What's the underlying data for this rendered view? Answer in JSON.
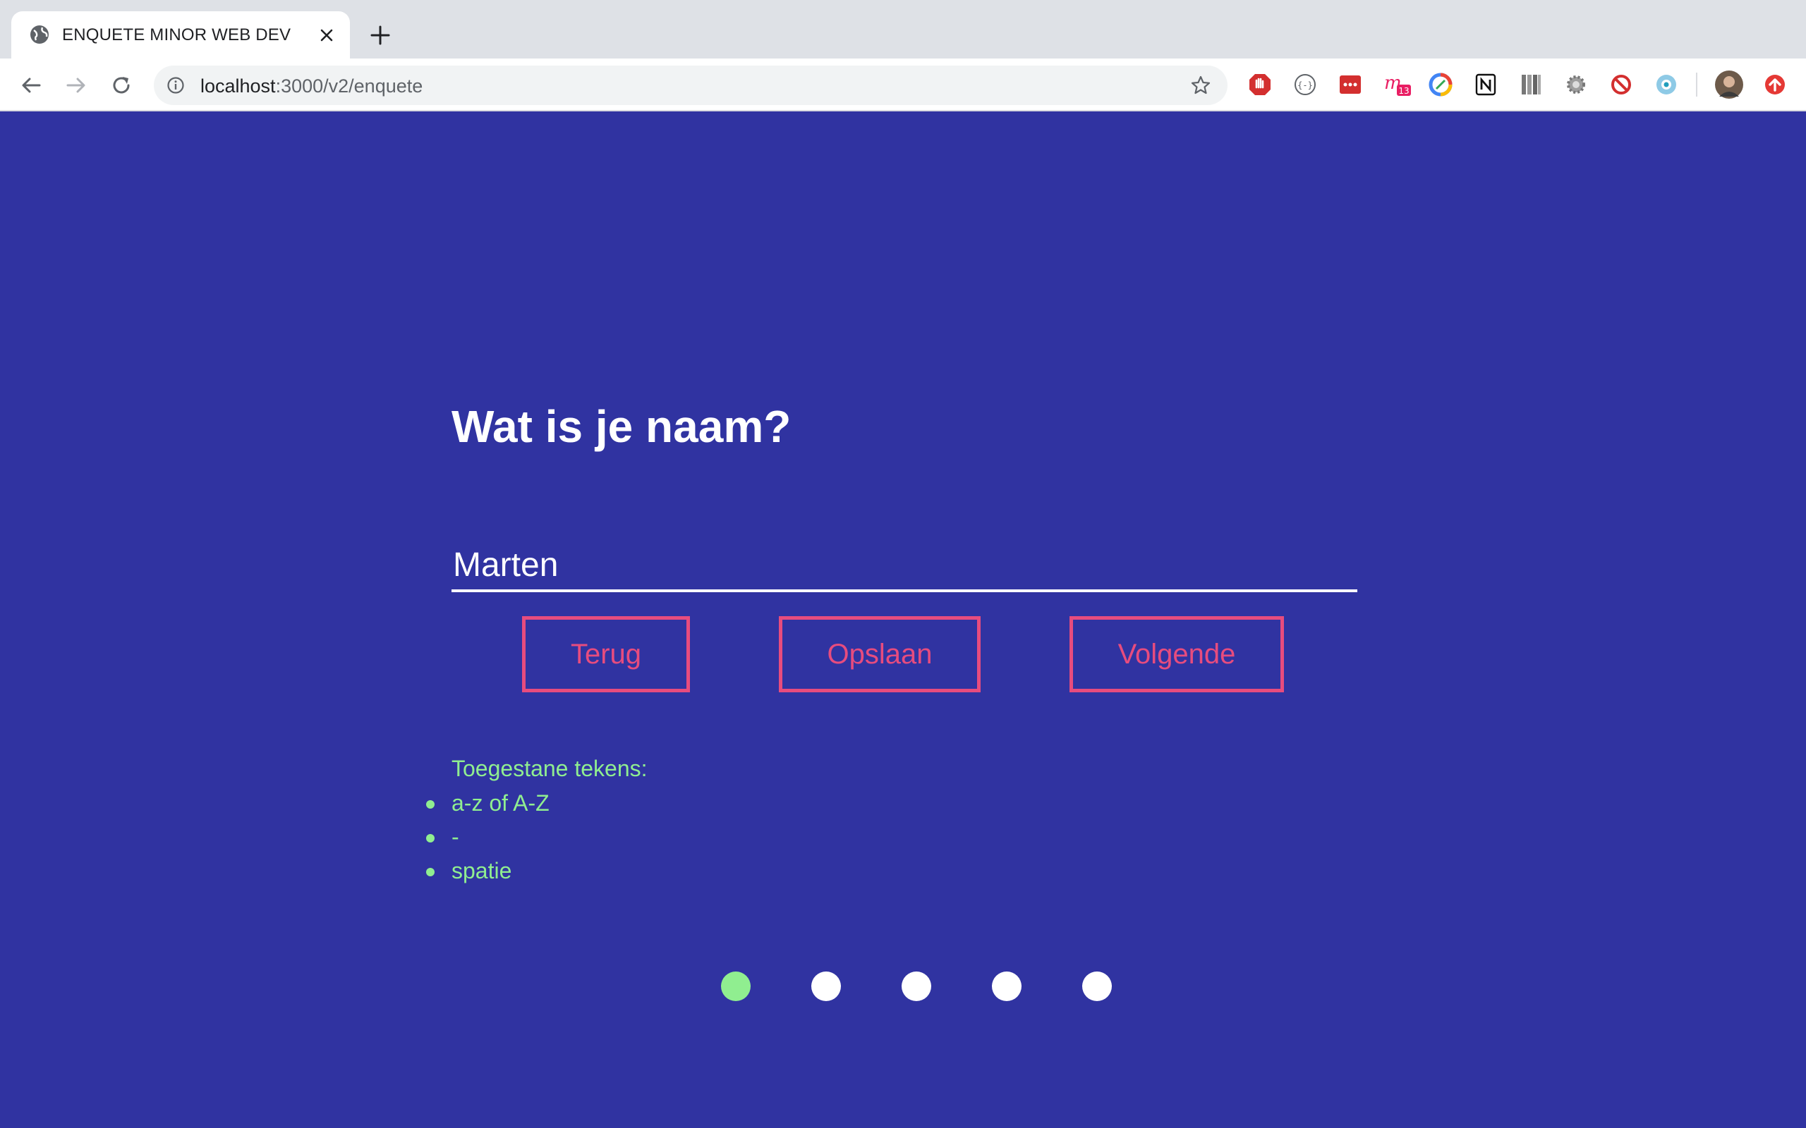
{
  "browser": {
    "tab": {
      "title": "ENQUETE MINOR WEB DEV"
    },
    "address": {
      "host": "localhost",
      "path": ":3000/v2/enquete"
    },
    "extensions": [
      "adblock-icon",
      "json-formatter-icon",
      "lastpass-icon",
      "mail-badge-icon",
      "color-picker-icon",
      "notion-icon",
      "archive-icon",
      "settings-gear-icon",
      "block-icon",
      "eye-icon",
      "profile-avatar",
      "update-icon"
    ],
    "badge_count": "13"
  },
  "page": {
    "question": "Wat is je naam?",
    "input": {
      "value": "Marten"
    },
    "buttons": {
      "back": "Terug",
      "save": "Opslaan",
      "next": "Volgende"
    },
    "hint": {
      "title": "Toegestane tekens:",
      "items": [
        "a-z of A-Z",
        "-",
        "spatie"
      ]
    },
    "progress": {
      "current_step": 1,
      "total_steps": 5
    }
  },
  "colors": {
    "background": "#3033a1",
    "accent": "#e74c7e",
    "hint": "#90ee90",
    "text": "#ffffff"
  }
}
